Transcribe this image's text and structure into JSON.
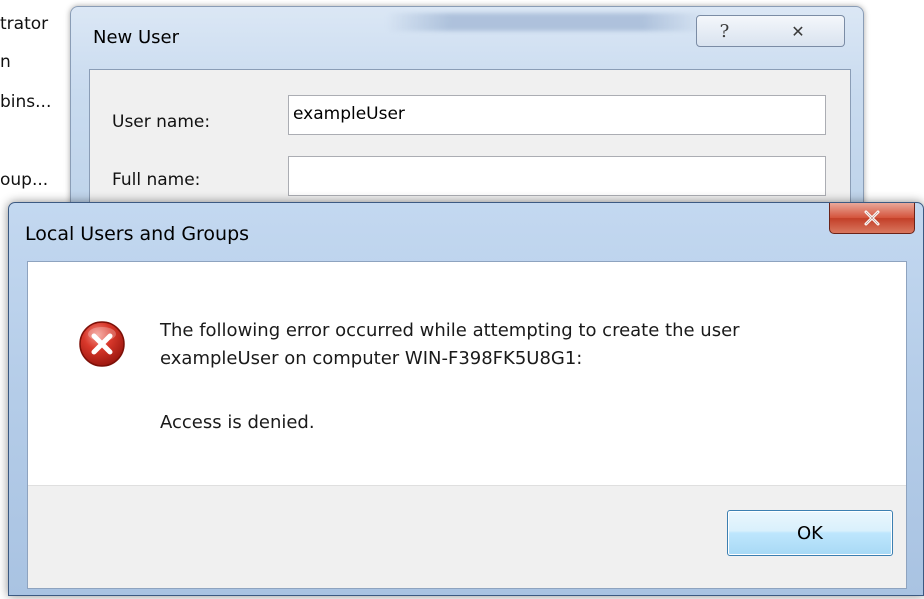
{
  "background_list": {
    "items": [
      "trator",
      "n",
      "bins...",
      "oup..."
    ]
  },
  "new_user_dialog": {
    "title": "New User",
    "help_icon": "?",
    "close_icon": "✕",
    "fields": {
      "user_name_label": "User name:",
      "user_name_value": "exampleUser",
      "full_name_label": "Full name:",
      "full_name_value": ""
    }
  },
  "error_dialog": {
    "title": "Local Users and Groups",
    "close_icon": "x",
    "icon": "error-icon",
    "message_line1": "The following error occurred while attempting to create the user",
    "message_line2": "exampleUser on computer WIN-F398FK5U8G1:",
    "detail": "Access is denied.",
    "ok_label": "OK"
  },
  "colors": {
    "error_red": "#c42a1f",
    "close_button_red": "#c33f28",
    "ok_button_border": "#3c7fb1"
  }
}
